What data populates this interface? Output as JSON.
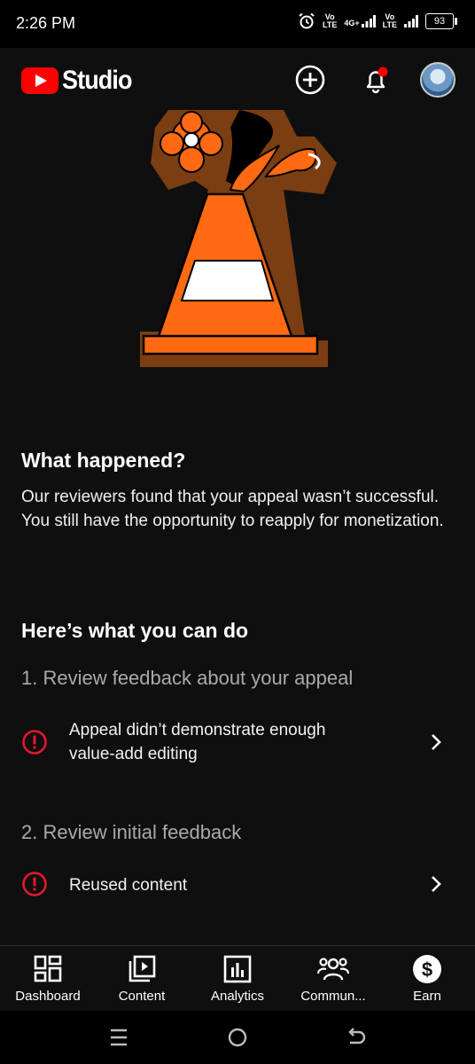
{
  "status_bar": {
    "time": "2:26 PM",
    "net1_top": "Vo",
    "net1_bottom": "LTE",
    "net2": "4G+",
    "net3_top": "Vo",
    "net3_bottom": "LTE",
    "battery": "93"
  },
  "app_bar": {
    "brand": "Studio",
    "icons": [
      "add-icon",
      "bell-icon",
      "avatar"
    ]
  },
  "what_happened": {
    "title": "What happened?",
    "body": "Our reviewers found that your appeal wasn’t successful. You still have the opportunity to reapply for monetization."
  },
  "next_steps": {
    "title": "Here’s what you can do",
    "step1": {
      "label": "1. Review feedback about your appeal",
      "item_line1": "Appeal didn’t demonstrate enough",
      "item_line2": "value-add editing"
    },
    "step2": {
      "label": "2. Review initial feedback",
      "item": "Reused content"
    }
  },
  "bottom_nav": {
    "dashboard": "Dashboard",
    "content": "Content",
    "analytics": "Analytics",
    "community": "Commun...",
    "earn": "Earn"
  },
  "colors": {
    "background": "#0f0f0f",
    "brand_red": "#ff0000",
    "alert_red": "#e3182d",
    "cone_orange": "#ff6a13",
    "cone_outline": "#7a3e12"
  }
}
